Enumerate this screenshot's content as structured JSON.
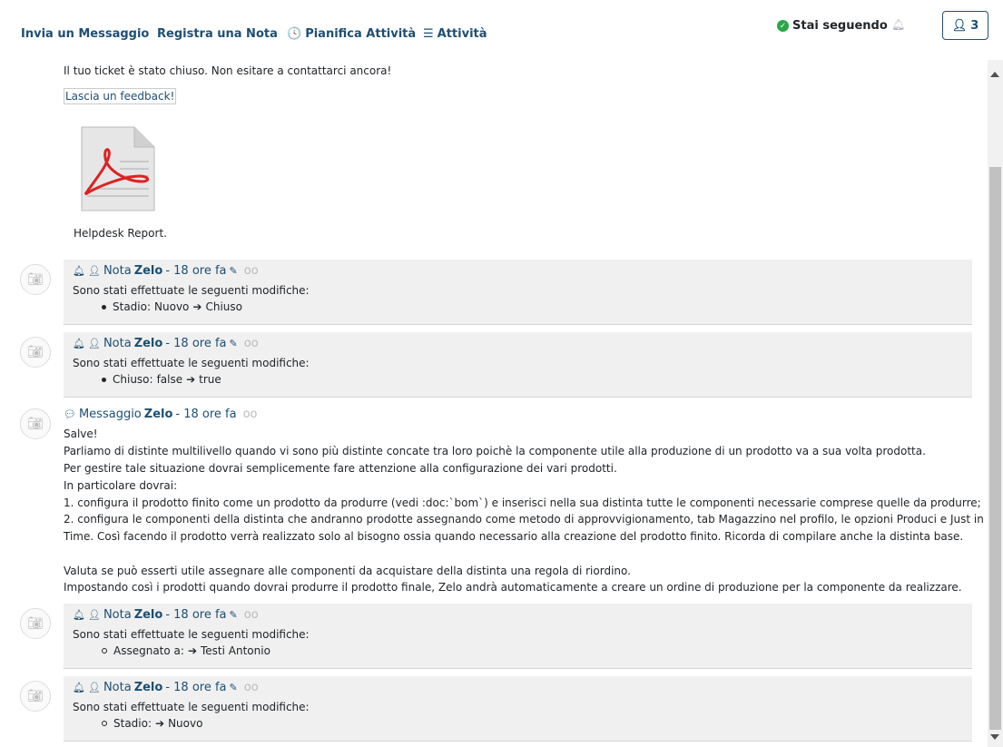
{
  "nav": {
    "send_message": "Invia un Messaggio",
    "log_note": "Registra una Nota",
    "schedule_activity": "Pianifica Attività",
    "activities": "Attività",
    "following": "Stai seguendo",
    "followers_count": "3"
  },
  "top": {
    "closed_text": "Il tuo ticket è stato chiuso. Non esitare a contattarci ancora!",
    "feedback_link": "Lascia un feedback!",
    "attachment_name": "Helpdesk Report.pdf"
  },
  "notes": [
    {
      "type": "Nota",
      "author": "Zelo",
      "time": "- 18 ore fa",
      "body": "Sono stati effettuate le seguenti modifiche:",
      "field": "Stadio:",
      "old": "Nuovo",
      "new": "Chiuso"
    },
    {
      "type": "Nota",
      "author": "Zelo",
      "time": "- 18 ore fa",
      "body": "Sono stati effettuate le seguenti modifiche:",
      "field": "Chiuso:",
      "old": "false",
      "new": "true"
    },
    {
      "type": "Nota",
      "author": "Zelo",
      "time": "- 18 ore fa",
      "body": "Sono stati effettuate le seguenti modifiche:",
      "field": "Assegnato a:",
      "old": "",
      "new": "Testi Antonio"
    },
    {
      "type": "Nota",
      "author": "Zelo",
      "time": "- 18 ore fa",
      "body": "Sono stati effettuate le seguenti modifiche:",
      "field": "Stadio:",
      "old": "",
      "new": "Nuovo"
    }
  ],
  "message": {
    "type": "Messaggio",
    "author": "Zelo",
    "time": "- 18 ore fa",
    "lines": [
      "Salve!",
      "Parliamo di distinte multilivello quando vi sono più distinte concate tra loro poichè la componente utile alla produzione di un prodotto va a sua volta prodotta.",
      "Per gestire tale situazione dovrai semplicemente fare attenzione alla configurazione dei vari prodotti.",
      "In particolare dovrai:",
      "1. configura il prodotto finito come un prodotto da produrre (vedi :doc:`bom`) e inserisci nella sua distinta tutte le componenti necessarie comprese quelle da produrre;",
      "2. configura le componenti della distinta che andranno prodotte assegnando come metodo di approvvigionamento, tab Magazzino nel profilo, le opzioni Produci e Just in",
      "Time. Così facendo il prodotto verrà realizzato solo al bisogno ossia quando necessario alla creazione del prodotto finito. Ricorda di compilare anche la distinta base.",
      "",
      "Valuta se può esserti utile assegnare alle componenti da acquistare della distinta una regola di riordino.",
      "Impostando così i prodotti quando dovrai produrre il prodotto finale, Zelo andrà automaticamente a creare un ordine di produzione per la componente da realizzare."
    ]
  }
}
